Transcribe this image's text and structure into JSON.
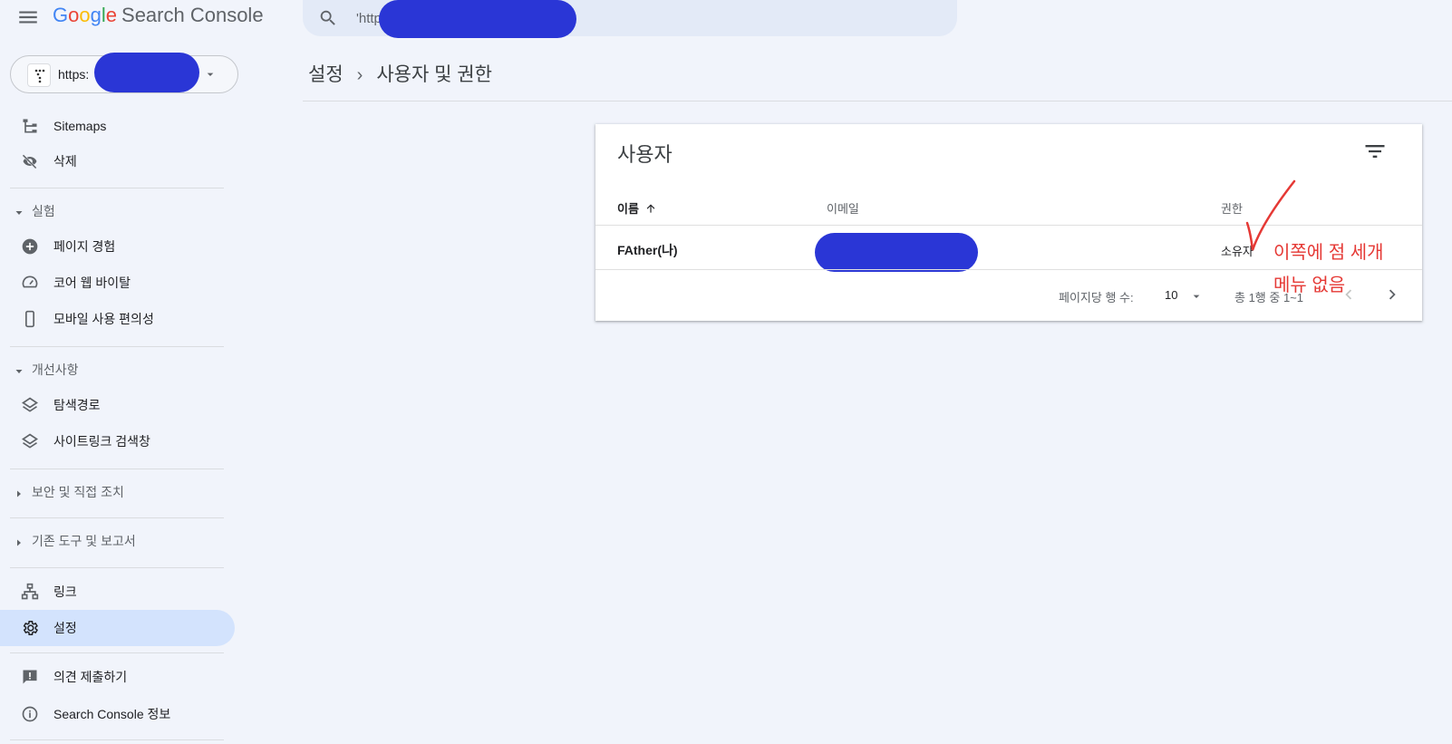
{
  "app": {
    "logo_google": [
      "G",
      "o",
      "o",
      "g",
      "l",
      "e"
    ],
    "product_name": "Search Console"
  },
  "search": {
    "placeholder": "'https://...'에 있는 모든 URL 검사"
  },
  "property": {
    "url": "https:"
  },
  "sidebar": {
    "top_items": [
      {
        "label": "Sitemaps",
        "icon": "sitemap-icon"
      },
      {
        "label": "삭제",
        "icon": "eye-off-icon"
      }
    ],
    "sections": [
      {
        "title": "실험",
        "expanded": true,
        "items": [
          {
            "label": "페이지 경험",
            "icon": "plus-circle-icon"
          },
          {
            "label": "코어 웹 바이탈",
            "icon": "speedometer-icon"
          },
          {
            "label": "모바일 사용 편의성",
            "icon": "phone-icon"
          }
        ]
      },
      {
        "title": "개선사항",
        "expanded": true,
        "items": [
          {
            "label": "탐색경로",
            "icon": "layers-icon"
          },
          {
            "label": "사이트링크 검색창",
            "icon": "layers-icon"
          }
        ]
      },
      {
        "title": "보안 및 직접 조치",
        "expanded": false,
        "items": []
      },
      {
        "title": "기존 도구 및 보고서",
        "expanded": false,
        "items": []
      }
    ],
    "bottom_items": [
      {
        "label": "링크",
        "icon": "links-icon"
      },
      {
        "label": "설정",
        "icon": "gear-icon",
        "active": true
      }
    ],
    "footer_items": [
      {
        "label": "의견 제출하기",
        "icon": "feedback-icon"
      },
      {
        "label": "Search Console 정보",
        "icon": "info-icon"
      }
    ]
  },
  "breadcrumb": {
    "parent": "설정",
    "current": "사용자 및 권한"
  },
  "users_card": {
    "title": "사용자",
    "columns": {
      "name": "이름",
      "email": "이메일",
      "permission": "권한"
    },
    "rows": [
      {
        "name": "FAther(나)",
        "permission": "소유자"
      }
    ],
    "pagination": {
      "rows_per_page_label": "페이지당 행 수:",
      "rows_per_page": "10",
      "range": "총 1행 중 1~1"
    }
  },
  "annotation": {
    "line1": "이쪽에 점 세개",
    "line2": "메뉴 없음",
    "color": "#e53935"
  },
  "colors": {
    "background": "#f1f4fb",
    "active_nav": "#d3e3fd",
    "redaction": "#2a36d6"
  }
}
